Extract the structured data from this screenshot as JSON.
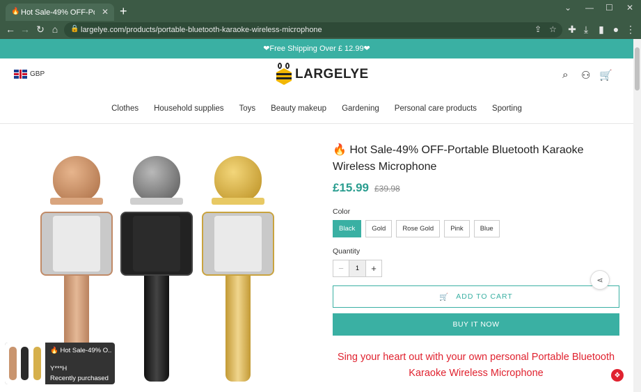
{
  "browser": {
    "tab_title": "Hot Sale-49% OFF-Portable B",
    "tab_favicon": "fire-icon",
    "url": "largelye.com/products/portable-bluetooth-karaoke-wireless-microphone"
  },
  "promo": {
    "text": "❤Free Shipping Over £ 12.99❤"
  },
  "header": {
    "currency": "GBP",
    "logo_text": "LARGELYE"
  },
  "nav": {
    "items": [
      "Clothes",
      "Household supplies",
      "Toys",
      "Beauty makeup",
      "Gardening",
      "Personal care products",
      "Sporting"
    ]
  },
  "product": {
    "title": "🔥 Hot Sale-49% OFF-Portable Bluetooth Karaoke Wireless Microphone",
    "price": "£15.99",
    "old_price": "£39.98",
    "color_label": "Color",
    "colors": [
      "Black",
      "Gold",
      "Rose Gold",
      "Pink",
      "Blue"
    ],
    "selected_color": "Black",
    "quantity_label": "Quantity",
    "quantity": "1",
    "add_to_cart": "ADD TO CART",
    "buy_now": "BUY IT NOW",
    "tagline_line1": "Sing your heart out with your own personal Portable Bluetooth",
    "tagline_line2": "Karaoke Wireless Microphone"
  },
  "popup": {
    "title": "🔥 Hot Sale-49% O...",
    "buyer": "Y***H",
    "status": "Recently purchased"
  },
  "colors": {
    "accent": "#3ab0a3",
    "chrome": "#3c5a45",
    "tagline": "#e0222f"
  }
}
